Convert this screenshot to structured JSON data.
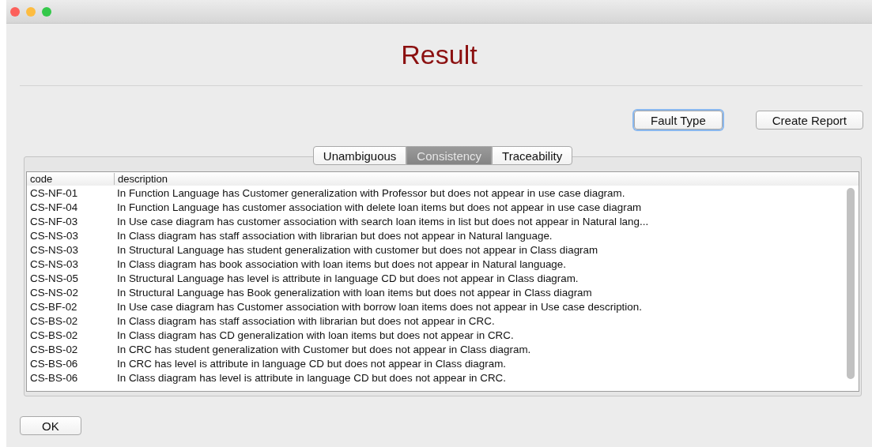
{
  "window": {
    "title": "Result"
  },
  "buttons": [
    {
      "label": "Fault Type",
      "focused": true
    },
    {
      "label": "Create Report",
      "focused": false
    }
  ],
  "tabs": [
    {
      "label": "Unambiguous",
      "selected": false
    },
    {
      "label": "Consistency",
      "selected": true
    },
    {
      "label": "Traceability",
      "selected": false
    }
  ],
  "table": {
    "columns": [
      "code",
      "description"
    ],
    "rows": [
      [
        "CS-NF-01",
        "In Function Language has Customer generalization with Professor but does not appear in use case diagram."
      ],
      [
        "CS-NF-04",
        "In Function Language has customer association with delete loan items but does not appear in use case diagram"
      ],
      [
        "CS-NF-03",
        "In Use case diagram has customer association with search loan items in list but does not appear in Natural lang..."
      ],
      [
        "CS-NS-03",
        "In Class diagram has staff association with librarian but does not appear in Natural language."
      ],
      [
        "CS-NS-03",
        "In Structural Language has student generalization with customer but does not appear in Class diagram"
      ],
      [
        "CS-NS-03",
        "In Class diagram has book association with loan items but does not appear in Natural language."
      ],
      [
        "CS-NS-05",
        "In Structural Language has level is attribute in language CD but does not appear in Class diagram."
      ],
      [
        "CS-NS-02",
        "In Structural Language has Book generalization with loan items but does not appear in Class diagram"
      ],
      [
        "CS-BF-02",
        "In Use case diagram has Customer association with borrow loan items does not appear in Use case description."
      ],
      [
        "CS-BS-02",
        "In Class diagram has staff association with librarian but does not appear in CRC."
      ],
      [
        "CS-BS-02",
        "In Class diagram has CD generalization with loan items but does not appear in CRC."
      ],
      [
        "CS-BS-02",
        "In CRC has student generalization with Customer but does not appear in Class diagram."
      ],
      [
        "CS-BS-06",
        "In CRC has level is attribute in language CD but does not appear in Class diagram."
      ],
      [
        "CS-BS-06",
        "In Class diagram has level is attribute in language CD but does not appear in CRC."
      ]
    ]
  },
  "ok_button": {
    "label": "OK"
  }
}
